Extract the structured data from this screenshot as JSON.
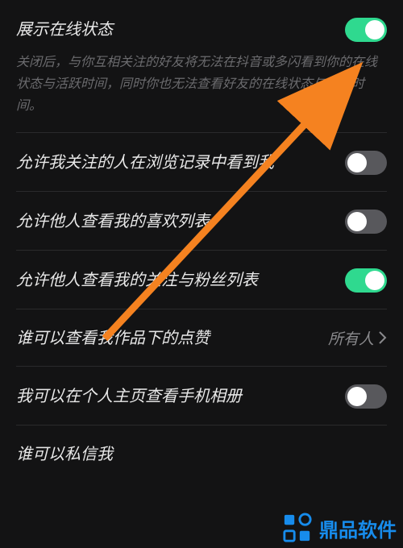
{
  "settings": {
    "online_status": {
      "title": "展示在线状态",
      "desc": "关闭后，与你互相关注的好友将无法在抖音或多闪看到你的在线状态与活跃时间，同时你也无法查看好友的在线状态与活跃时间。",
      "on": true
    },
    "browsing_history": {
      "title": "允许我关注的人在浏览记录中看到我",
      "on": false
    },
    "likes_list": {
      "title": "允许他人查看我的喜欢列表",
      "on": false
    },
    "follow_fans_list": {
      "title": "允许他人查看我的关注与粉丝列表",
      "on": true
    },
    "work_likes_viewer": {
      "title": "谁可以查看我作品下的点赞",
      "value": "所有人"
    },
    "album_view": {
      "title": "我可以在个人主页查看手机相册",
      "on": false
    },
    "private_message": {
      "title": "谁可以私信我"
    }
  },
  "watermark": {
    "text": "鼎品软件"
  }
}
